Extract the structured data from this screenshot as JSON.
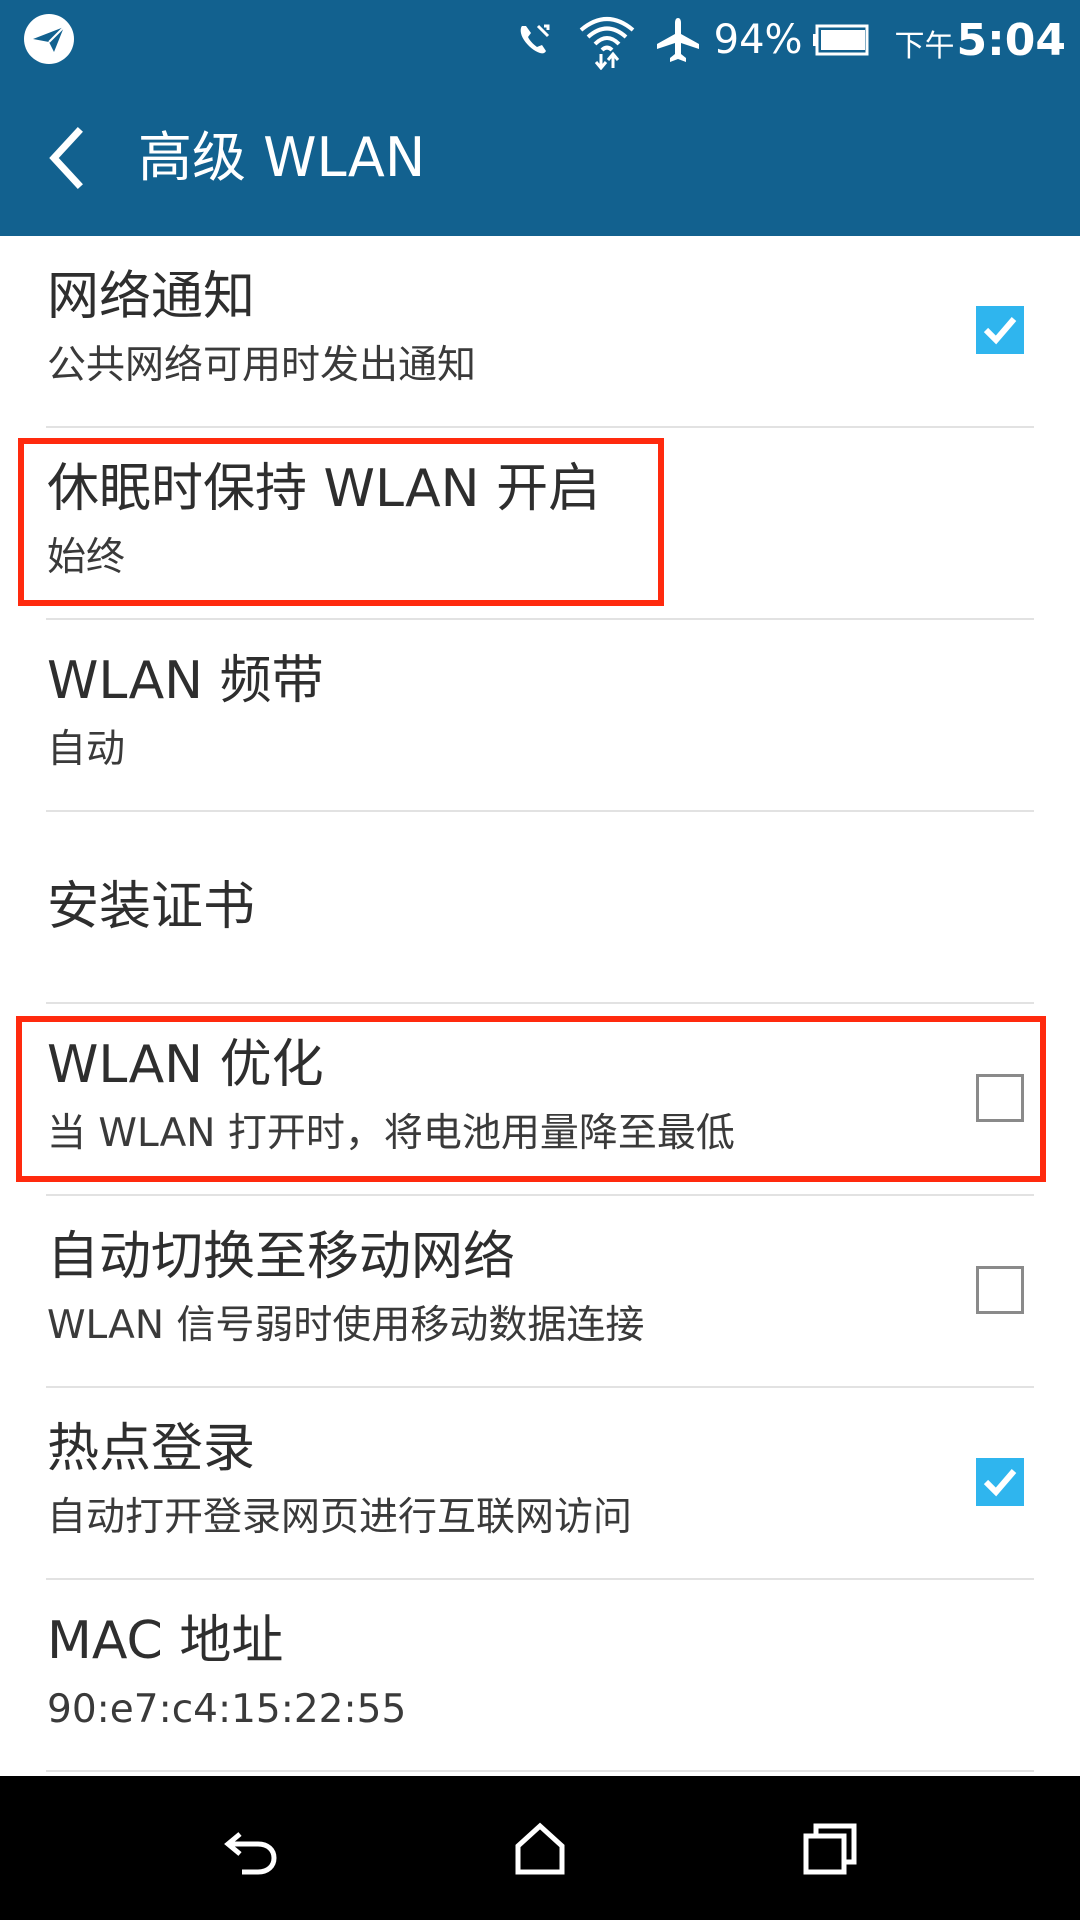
{
  "status_bar": {
    "app_icon": "paper-plane-icon",
    "icons": [
      "missed-call-icon",
      "wifi-icon",
      "airplane-mode-icon",
      "battery-icon"
    ],
    "battery_percent": "94%",
    "ampm": "下午",
    "time": "5:04"
  },
  "app_bar": {
    "back_icon": "chevron-left-icon",
    "title": "高级 WLAN"
  },
  "settings": [
    {
      "title": "网络通知",
      "subtitle": "公共网络可用时发出通知",
      "checkbox": "checked"
    },
    {
      "title": "休眠时保持 WLAN 开启",
      "subtitle": "始终"
    },
    {
      "title": "WLAN 频带",
      "subtitle": "自动"
    },
    {
      "title": "安装证书"
    },
    {
      "title": "WLAN 优化",
      "subtitle": "当 WLAN 打开时，将电池用量降至最低",
      "checkbox": "unchecked"
    },
    {
      "title": "自动切换至移动网络",
      "subtitle": "WLAN 信号弱时使用移动数据连接",
      "checkbox": "unchecked"
    },
    {
      "title": "热点登录",
      "subtitle": "自动打开登录网页进行互联网访问",
      "checkbox": "checked"
    },
    {
      "title": "MAC 地址",
      "subtitle": "90:e7:c4:15:22:55"
    }
  ],
  "colors": {
    "primary": "#12618f",
    "checkbox_on": "#2fb5ee",
    "highlight": "#ff2a0e"
  },
  "nav_bar": {
    "icons": [
      "back-icon",
      "home-icon",
      "recents-icon"
    ]
  }
}
